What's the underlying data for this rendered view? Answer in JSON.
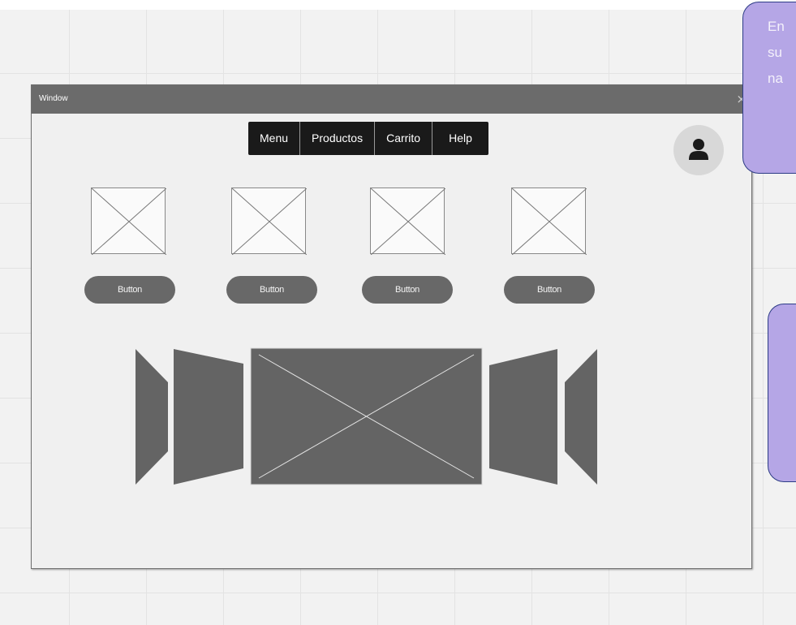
{
  "window": {
    "title": "Window",
    "close_glyph": "×"
  },
  "nav": {
    "items": [
      "Menu",
      "Productos",
      "Carrito",
      "Help"
    ]
  },
  "avatar": {
    "icon": "user-icon"
  },
  "products": [
    {
      "button_label": "Button"
    },
    {
      "button_label": "Button"
    },
    {
      "button_label": "Button"
    },
    {
      "button_label": "Button"
    }
  ],
  "carousel": {
    "icon": "image-placeholder-icon"
  },
  "notes": [
    {
      "lines": [
        "En",
        "su",
        "na"
      ]
    },
    {
      "lines": [
        "",
        ""
      ]
    }
  ],
  "colors": {
    "note_fill": "#b5a6e6",
    "note_border": "#2d3c86",
    "titlebar": "#6b6b6b",
    "navbar": "#1a1a1a",
    "button": "#686868"
  }
}
